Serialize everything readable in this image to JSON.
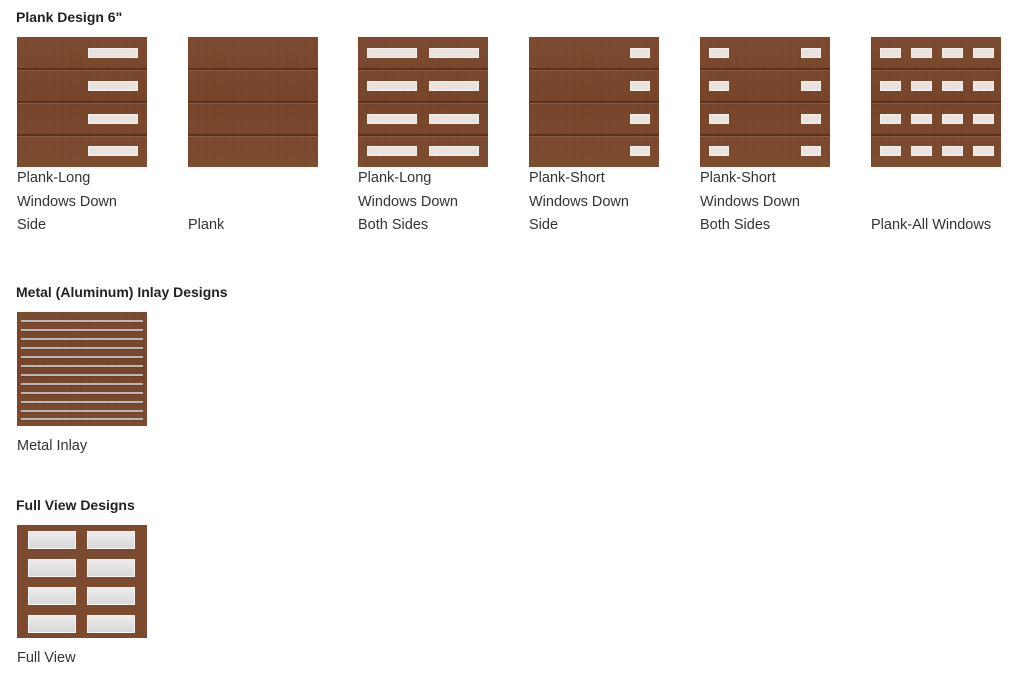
{
  "sections": {
    "plank": {
      "title": "Plank Design 6\""
    },
    "metal": {
      "title": "Metal (Aluminum) Inlay Designs"
    },
    "fullview": {
      "title": "Full View Designs"
    }
  },
  "plank_items": [
    {
      "lines": [
        "Plank-Long",
        "Windows Down",
        "Side"
      ]
    },
    {
      "lines": [
        "Plank"
      ]
    },
    {
      "lines": [
        "Plank-Long",
        "Windows Down",
        "Both Sides"
      ]
    },
    {
      "lines": [
        "Plank-Short",
        "Windows Down",
        "Side"
      ]
    },
    {
      "lines": [
        "Plank-Short",
        "Windows Down",
        "Both Sides"
      ]
    },
    {
      "lines": [
        "Plank-All Windows"
      ]
    }
  ],
  "metal_items": [
    {
      "lines": [
        "Metal Inlay"
      ]
    }
  ],
  "fullview_items": [
    {
      "lines": [
        "Full View"
      ]
    }
  ],
  "colors": {
    "wood": "#7b4a2f",
    "window": "#e8e3df",
    "text": "#333333"
  }
}
